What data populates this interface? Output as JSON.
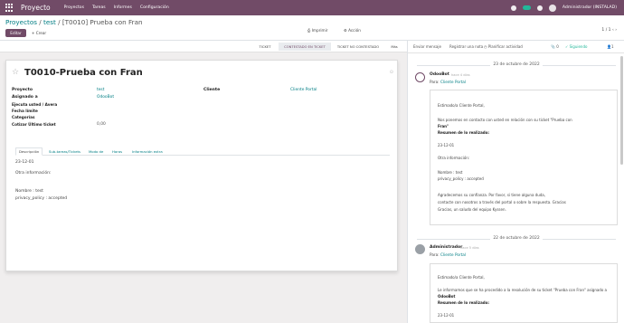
{
  "topbar": {
    "brand": "Proyecto",
    "menu": [
      "Proyectos",
      "Tareas",
      "Informes",
      "Configuración"
    ],
    "user": "Administrador (INSTALAD)"
  },
  "breadcrumb": {
    "items": [
      "Proyectos",
      "test"
    ],
    "separator": "/",
    "current": "[T0010] Prueba con Fran"
  },
  "actions": {
    "edit": "Editar",
    "create": "+ Crear",
    "print": "Imprimir",
    "action": "Acción",
    "pager": "1 / 1"
  },
  "statusbar": {
    "steps": [
      "TICKET",
      "CONTESTADO EN TICKET",
      "TICKET NO CONTESTADO",
      "Más"
    ],
    "active_index": 1
  },
  "form": {
    "title": "T0010-Prueba con Fran",
    "fields": [
      {
        "label": "Proyecto",
        "value": "test",
        "link": true
      },
      {
        "label": "Asignado a",
        "value": "OdooBot",
        "link": true
      },
      {
        "label": "Ejecuta usted / Avera",
        "value": ""
      },
      {
        "label": "Fecha límite",
        "value": ""
      },
      {
        "label": "Categorías",
        "value": ""
      },
      {
        "label": "Cotizar Último ticket",
        "value": "0,00",
        "link": false
      }
    ],
    "cliente_label": "Cliente",
    "cliente_value": "Cliente Portal",
    "tabs": [
      "Descripción",
      "Sub-tareas/Tickets",
      "Modo de",
      "Horas",
      "Información extra"
    ],
    "description": [
      "23-12-01",
      "Otra información:",
      "Nombre : test",
      "privacy_policy : accepted"
    ]
  },
  "chatter": {
    "topbar": {
      "send": "Enviar mensaje",
      "log": "Registrar una nota",
      "activity": "Planificar actividad",
      "attachments": "0",
      "follow": "Siguiendo",
      "followers": "1"
    },
    "messages": [
      {
        "date_sep": "23 de octubre de 2022",
        "author": "OdooBot",
        "time": "hace 4 días",
        "to_prefix": "Para: ",
        "to": "Cliente Portal",
        "lines": [
          "Estimado/a Cliente Portal,",
          "Nos ponemos en contacto con usted en relación con su ticket \"Prueba con",
          "Fran\"",
          "Resumen de lo realizado:",
          "23-12-01",
          "Otra información:",
          "Nombre : test",
          "privacy_policy : accepted",
          "Agradecemos su confianza. Por favor, si tiene alguna duda,",
          "contacte con nosotros a través del portal o sobre la respuesta. Gracias",
          "Gracias, un saludo del equipo Kyssen."
        ]
      },
      {
        "date_sep": "22 de octubre de 2022",
        "author": "Administrador",
        "time": "hace 5 días",
        "to_prefix": "Para: ",
        "to": "Cliente Portal",
        "lines": [
          "Estimado/a Cliente Portal,",
          "Le informamos que se ha procedido a la resolución de su ticket \"Prueba con Fran\" asignado a",
          "OdooBot",
          "Resumen de lo realizado:",
          "23-12-01"
        ]
      }
    ]
  },
  "colors": {
    "brand": "#714b67",
    "link": "#017e84",
    "follow": "#21b799"
  }
}
